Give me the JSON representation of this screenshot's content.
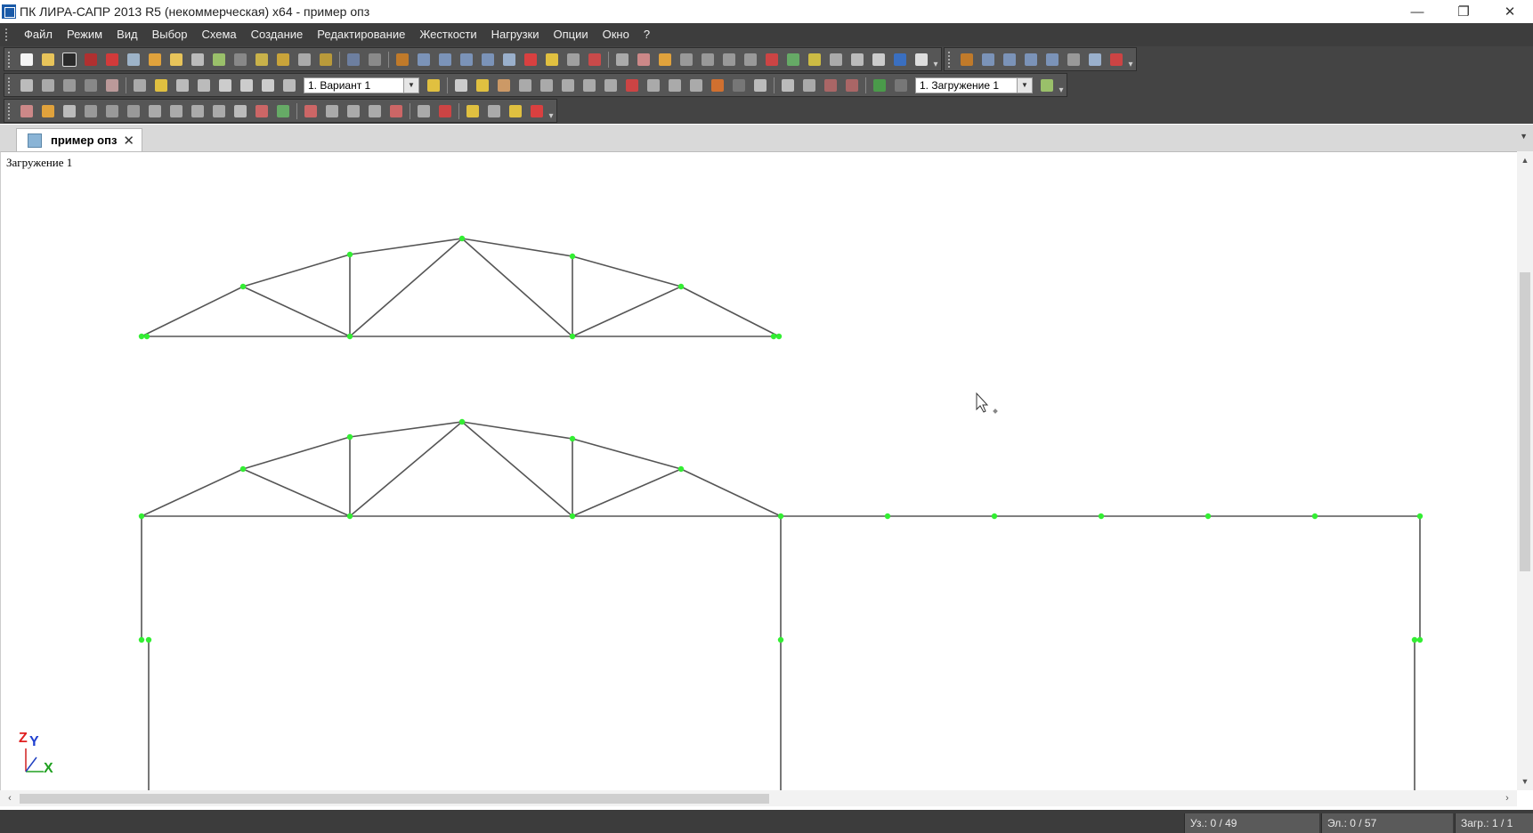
{
  "window": {
    "title": "ПК ЛИРА-САПР  2013 R5 (некоммерческая) x64 - пример опз",
    "minimize": "—",
    "restore": "❐",
    "close": "✕"
  },
  "menu": [
    "Файл",
    "Режим",
    "Вид",
    "Выбор",
    "Схема",
    "Создание",
    "Редактирование",
    "Жесткости",
    "Нагрузки",
    "Опции",
    "Окно",
    "?"
  ],
  "toolbar2": {
    "variant_combo": "1. Вариант 1",
    "load_combo": "1. Загружение 1"
  },
  "tab": {
    "label": "пример опз"
  },
  "canvas": {
    "label": "Загружение 1"
  },
  "axes": {
    "z": "Z",
    "y": "Y",
    "x": "X"
  },
  "status": {
    "nodes": "Уз.: 0 / 49",
    "elements": "Эл.: 0 / 57",
    "loads": "Загр.: 1 / 1"
  },
  "colors": {
    "node": "#33ee33",
    "member": "#555555"
  }
}
